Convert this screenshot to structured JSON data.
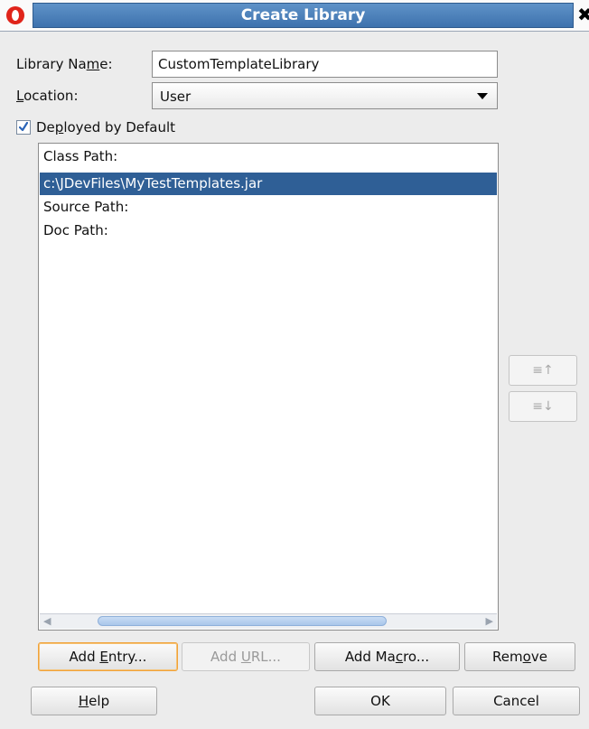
{
  "window": {
    "title": "Create Library",
    "close_glyph": "✖"
  },
  "form": {
    "library_name": {
      "label_pre": "Library Na",
      "label_u": "m",
      "label_post": "e:",
      "value": "CustomTemplateLibrary"
    },
    "location": {
      "label_pre": "",
      "label_u": "L",
      "label_post": "ocation:",
      "value": "User"
    },
    "deployed": {
      "label_pre": "De",
      "label_u": "p",
      "label_post": "loyed by Default",
      "checked": true
    }
  },
  "list": {
    "rows": [
      {
        "text": "Class Path:",
        "selected": false
      },
      {
        "text": "c:\\JDevFiles\\MyTestTemplates.jar",
        "selected": true
      },
      {
        "text": "Source Path:",
        "selected": false
      },
      {
        "text": "Doc Path:",
        "selected": false
      }
    ]
  },
  "side_buttons": {
    "up_glyph": "≡↑",
    "down_glyph": "≡↓"
  },
  "actions": {
    "add_entry": {
      "pre": "Add ",
      "u": "E",
      "post": "ntry..."
    },
    "add_url": {
      "pre": "Add ",
      "u": "U",
      "post": "RL..."
    },
    "add_macro": {
      "pre": "Add Ma",
      "u": "c",
      "post": "ro..."
    },
    "remove": {
      "pre": "Rem",
      "u": "o",
      "post": "ve"
    }
  },
  "footer": {
    "help": {
      "pre": "",
      "u": "H",
      "post": "elp"
    },
    "ok": "OK",
    "cancel": "Cancel"
  },
  "colors": {
    "accent": "#3e72ad",
    "selection": "#2f5f96",
    "focus": "#f0a23a"
  },
  "icons": [
    "oracle-app-icon",
    "close-icon",
    "chevron-down-icon",
    "check-icon",
    "move-up-icon",
    "move-down-icon"
  ]
}
